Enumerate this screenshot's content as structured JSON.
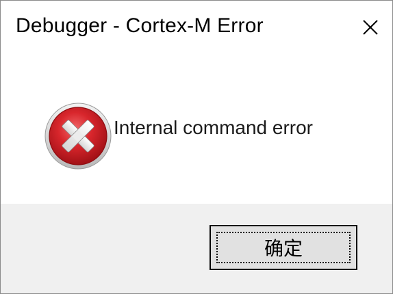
{
  "window": {
    "title": "Debugger - Cortex-M Error"
  },
  "message": {
    "text": "Internal command error",
    "icon": "error-icon"
  },
  "buttons": {
    "ok_label": "确定"
  },
  "icons": {
    "close": "close-icon"
  },
  "colors": {
    "error_red": "#c4161c",
    "footer_bg": "#f0f0f0",
    "button_bg": "#e1e1e1"
  }
}
